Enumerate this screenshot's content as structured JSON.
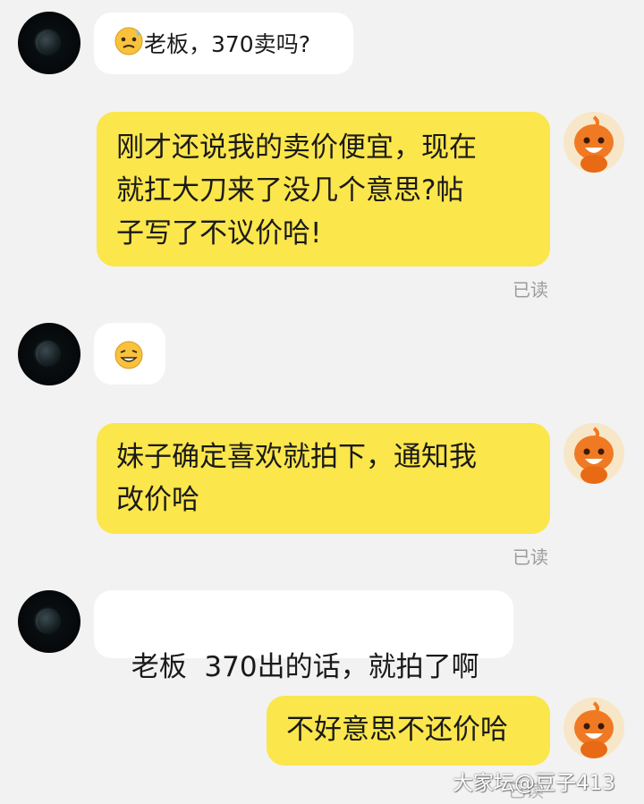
{
  "messages": [
    {
      "side": "left",
      "text": "老板，370卖吗?",
      "emoji": "anxious-sweat-emoji"
    },
    {
      "side": "right",
      "lines": [
        "刚才还说我的卖价便宜，现在",
        "就扛大刀来了没几个意思?帖",
        "子写了不议价哈!"
      ],
      "status": "已读"
    },
    {
      "side": "left",
      "emoji": "grin-squint-emoji"
    },
    {
      "side": "right",
      "lines": [
        "妹子确定喜欢就拍下，通知我",
        "改价哈"
      ],
      "status": "已读"
    },
    {
      "side": "left",
      "text": "老板  370出的话，就拍了啊"
    },
    {
      "side": "right",
      "text": "不好意思不还价哈",
      "status": "已读"
    }
  ],
  "watermark": "大家坛@豆子413",
  "colors": {
    "background": "#f2f2f2",
    "own_bubble": "#fbe64c",
    "other_bubble": "#ffffff",
    "read_label": "#9c9c9c",
    "avatar_orange": "#f07a23"
  }
}
